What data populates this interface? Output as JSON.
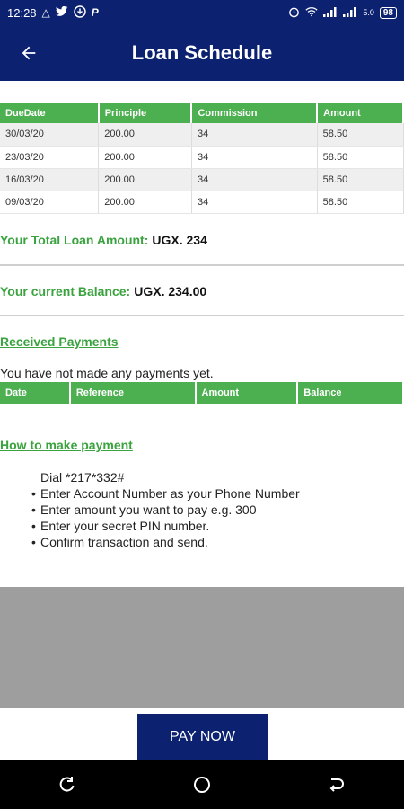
{
  "status_bar": {
    "time": "12:28",
    "network": "5.0",
    "battery": "98"
  },
  "app_bar": {
    "title": "Loan Schedule"
  },
  "schedule": {
    "headers": [
      "DueDate",
      "Principle",
      "Commission",
      "Amount"
    ],
    "rows": [
      [
        "30/03/20",
        "200.00",
        "34",
        "58.50"
      ],
      [
        "23/03/20",
        "200.00",
        "34",
        "58.50"
      ],
      [
        "16/03/20",
        "200.00",
        "34",
        "58.50"
      ],
      [
        "09/03/20",
        "200.00",
        "34",
        "58.50"
      ]
    ]
  },
  "total_loan": {
    "label": "Your Total Loan Amount:",
    "value": "UGX. 234"
  },
  "balance": {
    "label": "Your current Balance:",
    "value": "UGX. 234.00"
  },
  "payments": {
    "heading": "Received Payments",
    "empty_text": "You have not made any payments yet.",
    "headers": [
      "Date",
      "Reference",
      "Amount",
      "Balance"
    ]
  },
  "how_to": {
    "heading": "How to make payment",
    "dial_label": "Dial",
    "dial_code": "*217*332#",
    "steps": [
      "Enter Account Number as your Phone Number",
      "Enter amount you want to pay e.g. 300",
      "Enter your secret PIN number.",
      "Confirm transaction and send."
    ]
  },
  "pay_button": {
    "label": "PAY NOW"
  },
  "colors": {
    "primary": "#0c2170",
    "accent": "#4caf50",
    "accent_text": "#3aa33f",
    "gray_panel": "#9e9e9e"
  },
  "icons": {
    "back": "arrow-left-icon",
    "nav": [
      "recents-icon",
      "home-icon",
      "back-nav-icon"
    ]
  }
}
